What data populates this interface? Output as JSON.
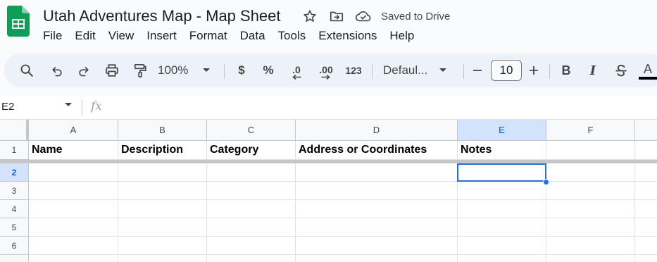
{
  "app": {
    "brand_color": "#0f9d58",
    "accent_color": "#1a73e8"
  },
  "title": "Utah Adventures Map - Map Sheet",
  "save_status": "Saved to Drive",
  "menu": [
    "File",
    "Edit",
    "View",
    "Insert",
    "Format",
    "Data",
    "Tools",
    "Extensions",
    "Help"
  ],
  "toolbar": {
    "zoom": "100%",
    "currency": "$",
    "percent": "%",
    "decrease_decimal": ".0",
    "increase_decimal": ".00",
    "number_format": "123",
    "font": "Defaul...",
    "font_size": "10",
    "bold": "B",
    "italic": "I",
    "text_color": "A"
  },
  "formula_bar": {
    "cell_ref": "E2",
    "fx": "fx",
    "value": ""
  },
  "sheet": {
    "columns": [
      "A",
      "B",
      "C",
      "D",
      "E",
      "F"
    ],
    "rows": [
      "1",
      "2",
      "3",
      "4",
      "5",
      "6"
    ],
    "selected_column": "E",
    "selected_row": "2",
    "header_row": [
      "Name",
      "Description",
      "Category",
      "Address or Coordinates",
      "Notes",
      ""
    ]
  }
}
